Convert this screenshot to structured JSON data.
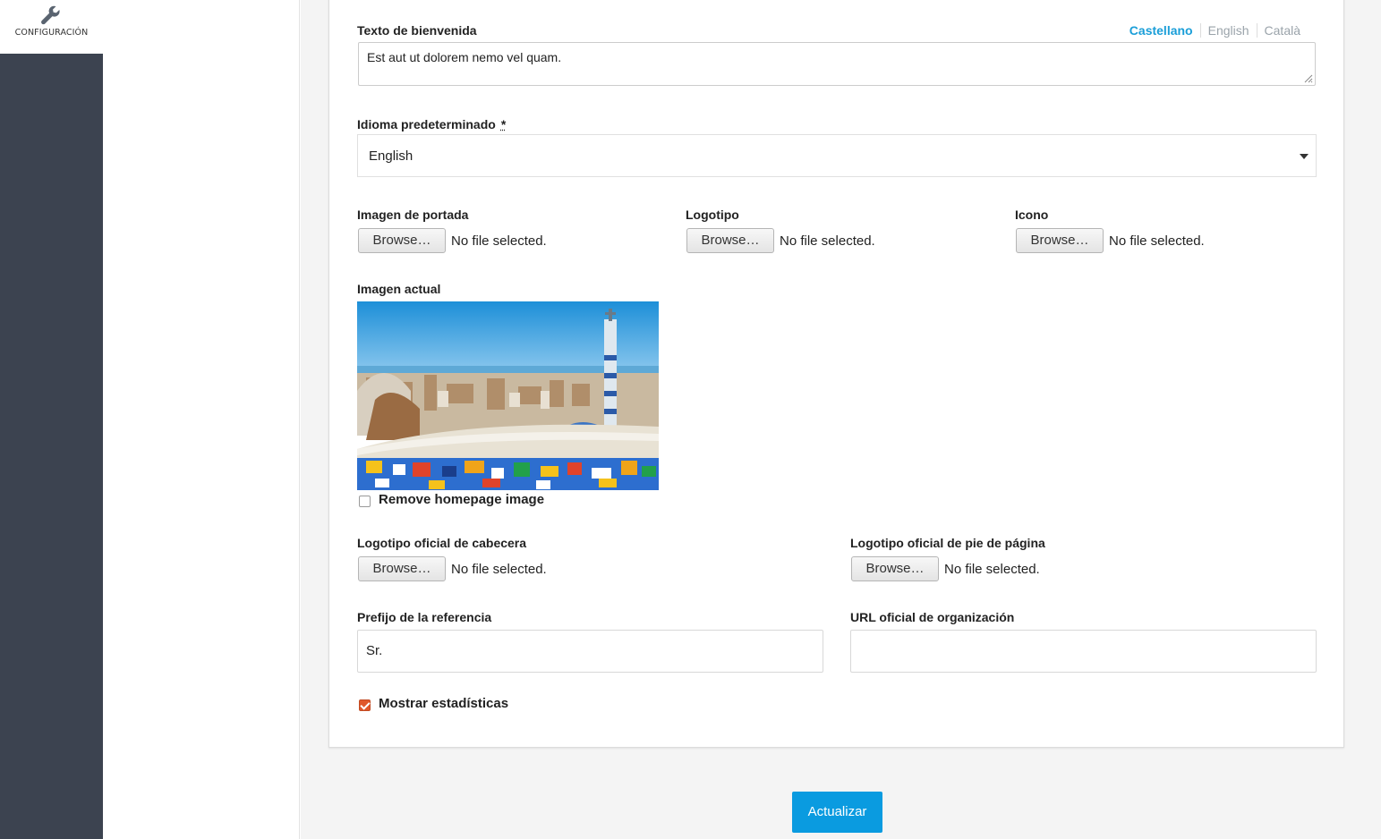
{
  "sidebar": {
    "active_item": {
      "icon": "wrench-icon",
      "label": "CONFIGURACIÓN"
    }
  },
  "form": {
    "welcome_text": {
      "label": "Texto de bienvenida",
      "value": "Est aut ut dolorem nemo vel quam.",
      "languages": [
        "Castellano",
        "English",
        "Català"
      ],
      "active_language": "Castellano"
    },
    "default_language": {
      "label": "Idioma predeterminado",
      "required_mark": "*",
      "selected": "English"
    },
    "cover_image": {
      "label": "Imagen de portada",
      "button": "Browse…",
      "status": "No file selected."
    },
    "logo": {
      "label": "Logotipo",
      "button": "Browse…",
      "status": "No file selected."
    },
    "icon": {
      "label": "Icono",
      "button": "Browse…",
      "status": "No file selected."
    },
    "current_image": {
      "label": "Imagen actual"
    },
    "remove_homepage_image": {
      "label": "Remove homepage image",
      "checked": false
    },
    "header_logo": {
      "label": "Logotipo oficial de cabecera",
      "button": "Browse…",
      "status": "No file selected."
    },
    "footer_logo": {
      "label": "Logotipo oficial de pie de página",
      "button": "Browse…",
      "status": "No file selected."
    },
    "reference_prefix": {
      "label": "Prefijo de la referencia",
      "value": "Sr."
    },
    "organization_url": {
      "label": "URL oficial de organización",
      "value": ""
    },
    "show_stats": {
      "label": "Mostrar estadísticas",
      "checked": true
    },
    "submit_label": "Actualizar"
  },
  "colors": {
    "accent": "#0a9be0",
    "sidebar_bg": "#3c4350",
    "checkbox_checked": "#e0572a",
    "active_language": "#1a9ed8"
  }
}
